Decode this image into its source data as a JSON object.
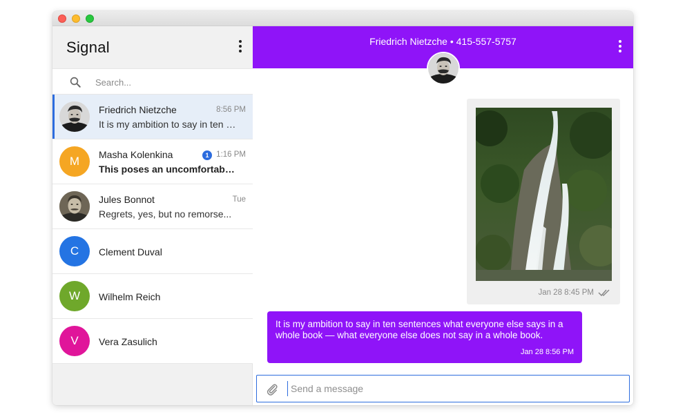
{
  "app": {
    "title": "Signal"
  },
  "theme": {
    "accent": "#8f14f8",
    "unread_badge": "#2c6cde"
  },
  "search": {
    "placeholder": "Search..."
  },
  "conversations": [
    {
      "name": "Friedrich Nietzche",
      "time": "8:56 PM",
      "snippet": "It is my ambition to say in ten sentences what everyone else says in a whole book",
      "avatar": "photo",
      "active": true
    },
    {
      "name": "Masha Kolenkina",
      "time": "1:16 PM",
      "snippet": "This poses an uncomfortable question",
      "avatar_letter": "M",
      "avatar_color": "#f5a623",
      "unread": "1"
    },
    {
      "name": "Jules Bonnot",
      "time": "Tue",
      "snippet": "Regrets, yes, but no remorse...",
      "avatar": "photo"
    },
    {
      "name": "Clement Duval",
      "avatar_letter": "C",
      "avatar_color": "#2474e3"
    },
    {
      "name": "Wilhelm Reich",
      "avatar_letter": "W",
      "avatar_color": "#6fa82b"
    },
    {
      "name": "Vera Zasulich",
      "avatar_letter": "V",
      "avatar_color": "#e0159a"
    }
  ],
  "header": {
    "contact": "Friedrich Nietzche • 415-557-5757"
  },
  "messages": {
    "incoming_image": {
      "time": "Jan 28 8:45 PM",
      "status_icon": "double-check-icon"
    },
    "outgoing_text": {
      "text": "It is my ambition to say in ten sentences what everyone else says in a whole book — what everyone else does not say in a whole book.",
      "time": "Jan 28 8:56 PM"
    }
  },
  "composer": {
    "placeholder": "Send a message"
  }
}
